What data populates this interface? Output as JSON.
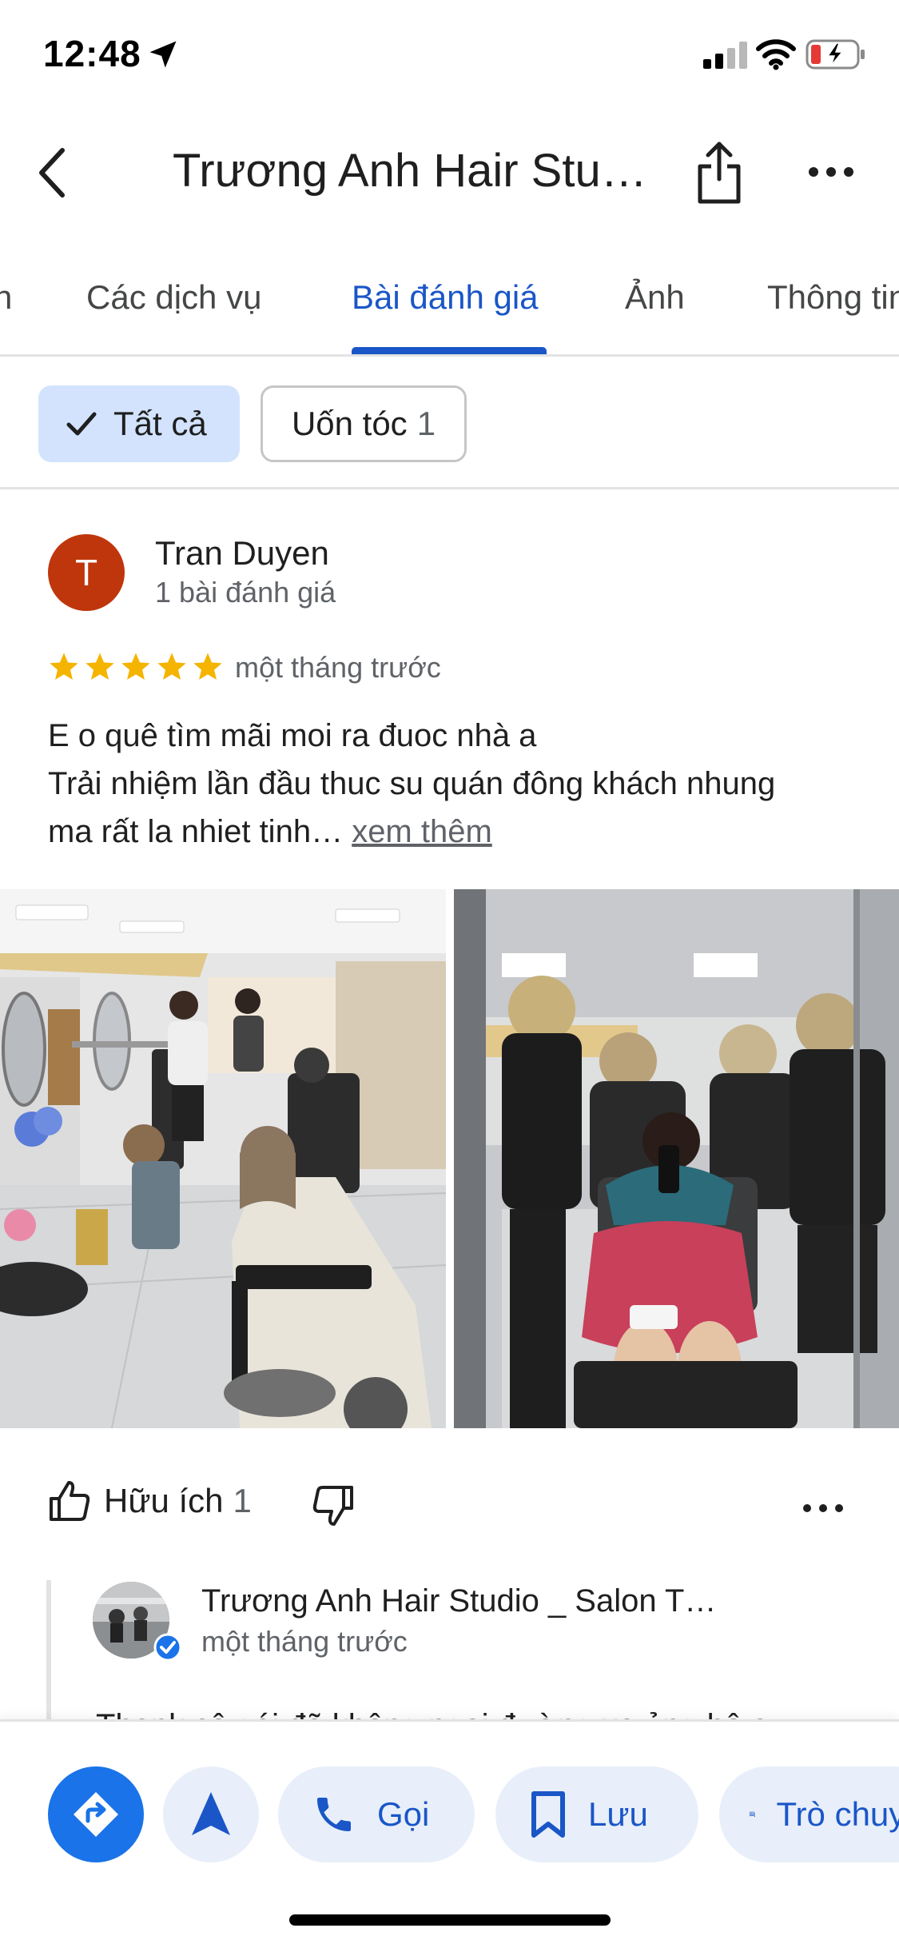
{
  "status": {
    "time": "12:48",
    "icons": [
      "location-arrow-icon",
      "cellular-signal-icon",
      "wifi-icon",
      "battery-charging-icon"
    ]
  },
  "header": {
    "title": "Trương Anh Hair Stu…",
    "back_icon": "chevron-left-icon",
    "share_icon": "share-icon",
    "more_icon": "more-horizontal-icon"
  },
  "tabs": [
    {
      "label": "n"
    },
    {
      "label": "Các dịch vụ"
    },
    {
      "label": "Bài đánh giá",
      "active": true
    },
    {
      "label": "Ảnh"
    },
    {
      "label": "Thông tin"
    }
  ],
  "filters": {
    "all": "Tất cả",
    "perm": "Uốn tóc",
    "perm_count": "1"
  },
  "review": {
    "author_initial": "T",
    "author_name": "Tran Duyen",
    "author_meta": "1 bài đánh giá",
    "rating": 5,
    "time": "một tháng trước",
    "text_line1": "E o quê tìm mãi moi ra đuoc nhà a",
    "text_line2": "Trải nhiệm lần đầu thuc su quán đông khách nhung",
    "text_line3": "ma rất la nhiet tinh…",
    "more_link": "xem thêm",
    "helpful_label": "Hữu ích",
    "helpful_count": "1"
  },
  "reply": {
    "owner_name": "Trương Anh Hair Studio _ Salon T…",
    "time": "một tháng trước",
    "text": "Thank cô gái đã không ngại đường xa ủng hộ a"
  },
  "bottom": {
    "call": "Gọi",
    "save": "Lưu",
    "chat": "Trò chuyện"
  },
  "colors": {
    "accent": "#1a56c7",
    "star": "#f4b400",
    "avatar": "#bf360c",
    "chip_active": "#d3e3fd"
  }
}
